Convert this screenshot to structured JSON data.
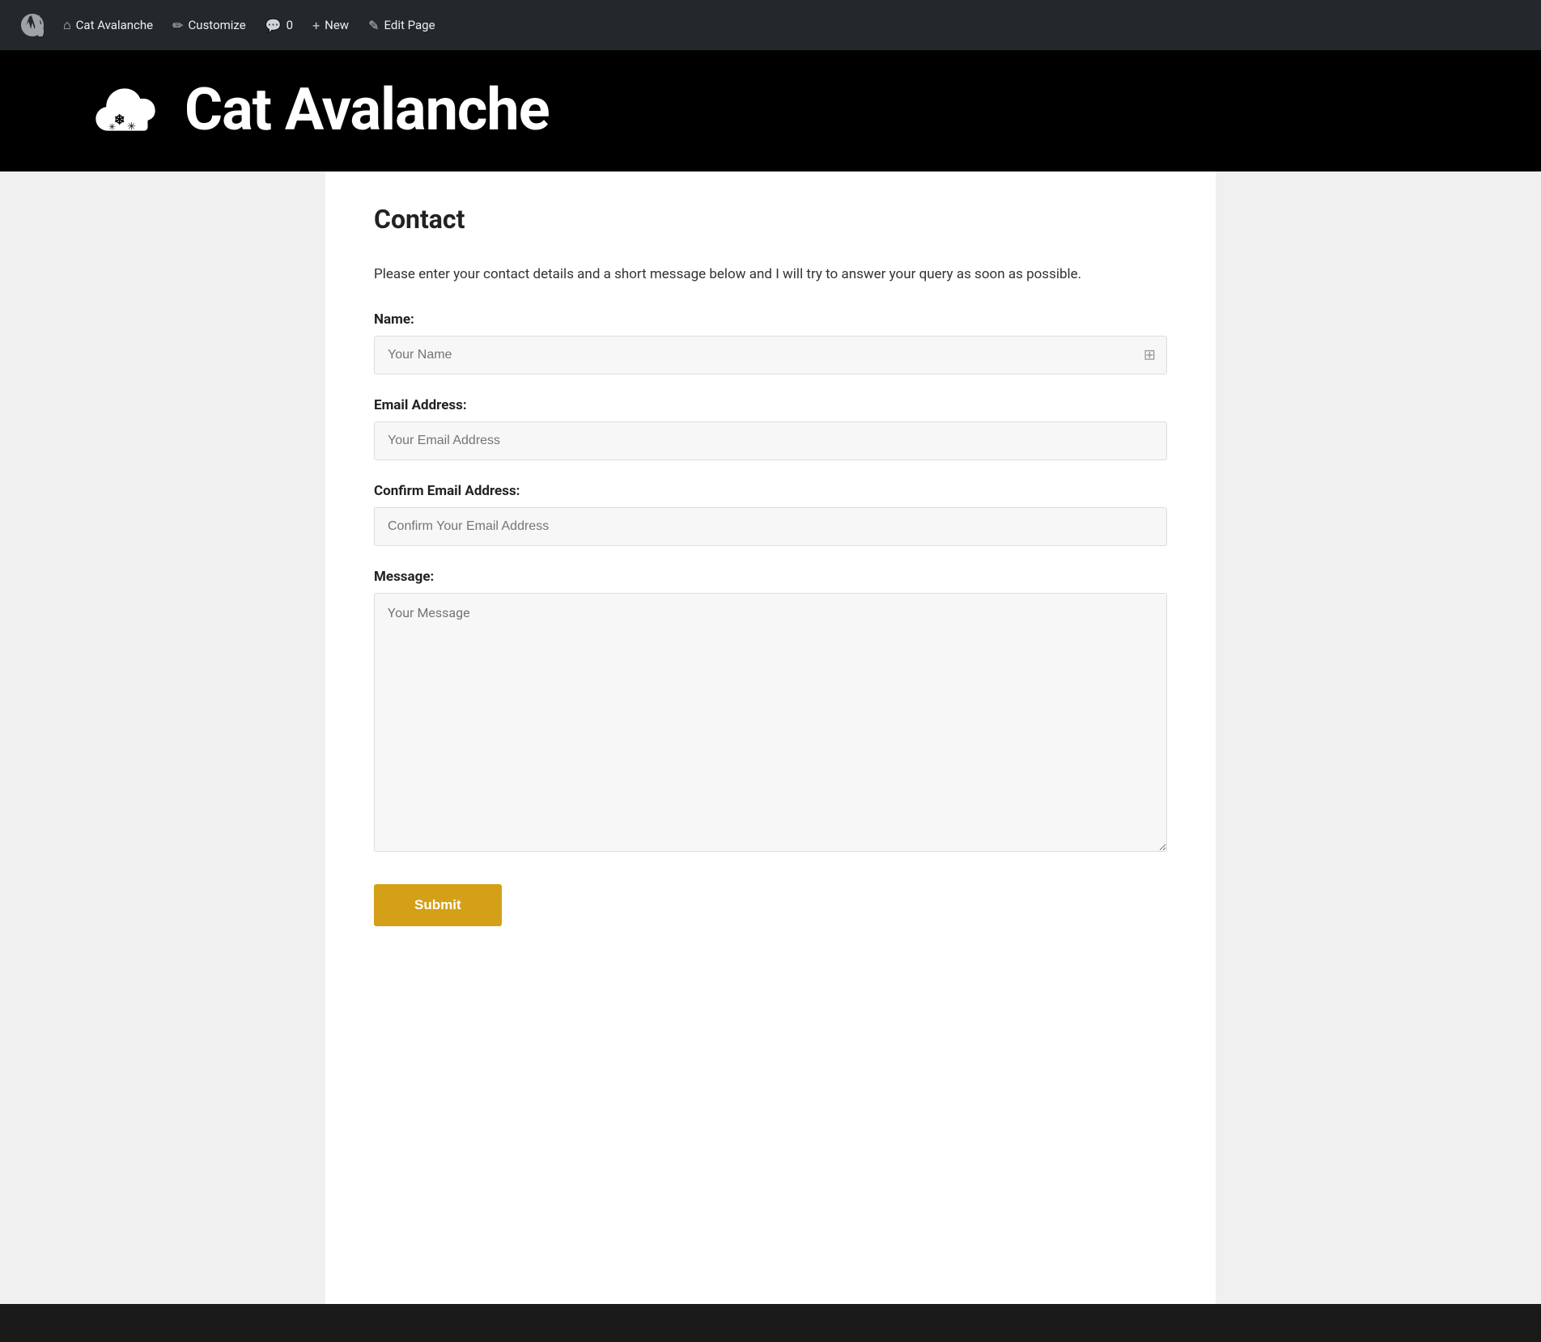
{
  "adminBar": {
    "wpIcon": "wordpress-icon",
    "items": [
      {
        "id": "site-name",
        "label": "Cat Avalanche",
        "icon": "home-icon"
      },
      {
        "id": "customize",
        "label": "Customize",
        "icon": "paint-icon"
      },
      {
        "id": "comments",
        "label": "0",
        "icon": "comment-icon"
      },
      {
        "id": "new",
        "label": "New",
        "icon": "plus-icon"
      },
      {
        "id": "edit-page",
        "label": "Edit Page",
        "icon": "pencil-icon"
      }
    ]
  },
  "siteHeader": {
    "title": "Cat Avalanche",
    "logoAlt": "Cat Avalanche logo"
  },
  "page": {
    "title": "Contact",
    "introText": "Please enter your contact details and a short message below and I will try to answer your query as soon as possible.",
    "form": {
      "nameLabelText": "Name:",
      "nameFieldPlaceholder": "Your Name",
      "emailLabelText": "Email Address:",
      "emailFieldPlaceholder": "Your Email Address",
      "confirmEmailLabelText": "Confirm Email Address:",
      "confirmEmailFieldPlaceholder": "Confirm Your Email Address",
      "messageLabelText": "Message:",
      "messageFieldPlaceholder": "Your Message",
      "submitLabel": "Submit"
    }
  }
}
